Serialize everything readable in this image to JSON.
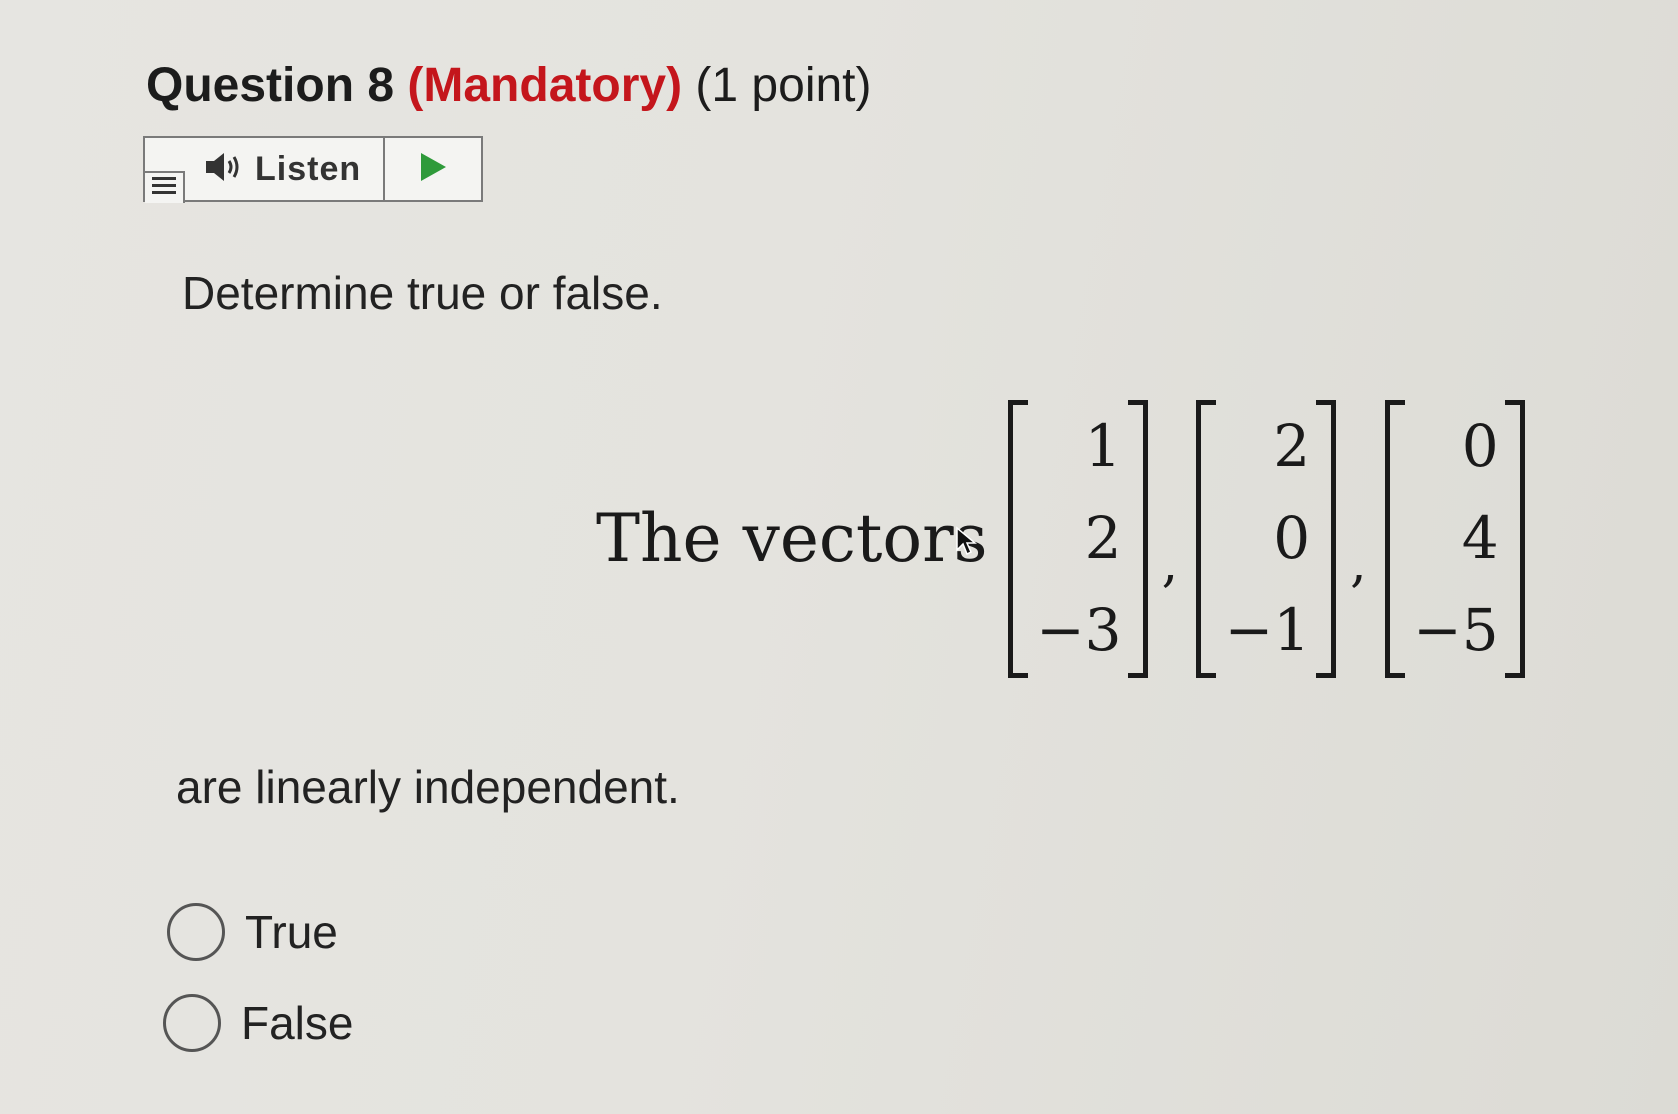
{
  "question": {
    "number_label": "Question 8",
    "mandatory_label": "(Mandatory)",
    "points_label": "(1 point)"
  },
  "listen": {
    "label": "Listen",
    "menu_icon": "menu-icon",
    "speaker_icon": "speaker-icon",
    "play_icon": "play-icon",
    "play_color": "#2e9a3a"
  },
  "prompt": "Determine true or false.",
  "statement": {
    "lead_text": "The vectors",
    "vectors": [
      [
        "1",
        "2",
        "−3"
      ],
      [
        "2",
        "0",
        "−1"
      ],
      [
        "0",
        "4",
        "−5"
      ]
    ],
    "separator": ",",
    "conclusion": "are linearly independent."
  },
  "options": [
    {
      "label": "True",
      "selected": false
    },
    {
      "label": "False",
      "selected": false
    }
  ]
}
